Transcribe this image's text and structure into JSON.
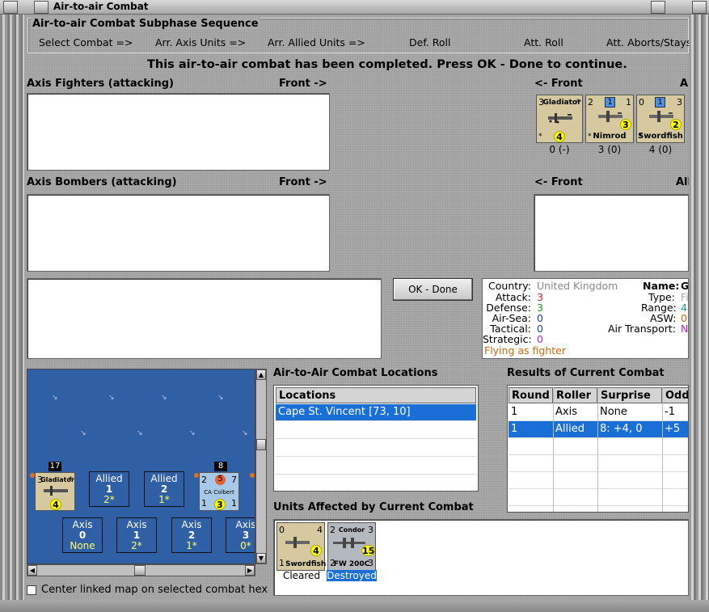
{
  "window": {
    "title": "Air-to-air Combat"
  },
  "sequence": {
    "title": "Air-to-air Combat Subphase Sequence",
    "steps": [
      "Select Combat =>",
      "Arr. Axis Units =>",
      "Arr. Allied Units =>",
      "Def. Roll",
      "Att. Roll",
      "Att. Aborts/Stays"
    ]
  },
  "message": "This air-to-air combat has been completed.  Press OK - Done to continue.",
  "axis_fighters": {
    "label": "Axis Fighters (attacking)",
    "front": "Front ->"
  },
  "axis_bombers": {
    "label": "Axis Bombers (attacking)",
    "front": "Front ->"
  },
  "allied_fighters": {
    "front": "<- Front",
    "label_cut": "A"
  },
  "allied_bombers": {
    "front": "<- Front",
    "label_cut": "All"
  },
  "allied_units": [
    {
      "name": "Gladiator",
      "tl": "3",
      "tr": "*",
      "circle": "4",
      "status": "0 (-)"
    },
    {
      "name": "Nimrod",
      "tl": "2",
      "tr": "1",
      "box": "1",
      "circle": "3",
      "status": "3 (0)"
    },
    {
      "name": "Swordfish",
      "tl": "0",
      "tr": "3",
      "box": "1",
      "circle": "2",
      "status": "4 (0)"
    }
  ],
  "ok_button": "OK - Done",
  "info": {
    "country_label": "Country:",
    "country": "United Kingdom",
    "attack_label": "Attack:",
    "attack": "3",
    "defense_label": "Defense:",
    "defense": "3",
    "airsea_label": "Air-Sea:",
    "airsea": "0",
    "tactical_label": "Tactical:",
    "tactical": "0",
    "strategic_label": "Strategic:",
    "strategic": "0",
    "flying": "Flying as fighter",
    "name_label": "Name:",
    "name": "G",
    "type_label": "Type:",
    "type": "Fi",
    "range_label": "Range:",
    "range": "4",
    "asw_label": "ASW:",
    "asw": "0",
    "airtransport_label": "Air Transport:",
    "airtransport": "No",
    "colors": {
      "country": "#8a8a8a",
      "attack": "#d02020",
      "defense": "#1a9a1a",
      "airsea": "#1a40c0",
      "tactical": "#1a40c0",
      "strategic": "#c020c0",
      "flying": "#c86a10"
    }
  },
  "map": {
    "stack1": {
      "count": "17",
      "name": "Gladiator",
      "tl": "3",
      "tr": "*",
      "circle": "4"
    },
    "stack2": {
      "count": "8",
      "name": "CA Colbert",
      "tl": "2",
      "mid": "5",
      "tr": "7",
      "bl": "1",
      "circle": "3",
      "br": "1"
    },
    "allied_cells": [
      {
        "title": "Allied",
        "value": "1",
        "sub": "2*"
      },
      {
        "title": "Allied",
        "value": "2",
        "sub": "1*"
      }
    ],
    "axis_cells": [
      {
        "title": "Axis",
        "value": "0",
        "sub": "None"
      },
      {
        "title": "Axis",
        "value": "1",
        "sub": "2*"
      },
      {
        "title": "Axis",
        "value": "2",
        "sub": "1*"
      },
      {
        "title": "Axis",
        "value": "3",
        "sub": "0*"
      }
    ]
  },
  "locations": {
    "title": "Air-to-Air Combat Locations",
    "header": "Locations",
    "rows": [
      "Cape St. Vincent [73, 10]"
    ]
  },
  "results": {
    "title": "Results of Current Combat",
    "headers": [
      "Round",
      "Roller",
      "Surprise",
      "Odds"
    ],
    "rows": [
      [
        "1",
        "Axis",
        "None",
        "-1"
      ],
      [
        "1",
        "Allied",
        "8: +4, 0",
        "+5"
      ]
    ]
  },
  "affected": {
    "title": "Units Affected by Current Combat",
    "units": [
      {
        "name": "Swordfish",
        "tl": "0",
        "tr": "4",
        "bl": "1",
        "circle": "4",
        "status": "Cleared"
      },
      {
        "name": "FW 200C",
        "top": "Condor",
        "tl": "2",
        "tr": "3",
        "bl": "2",
        "br": "3",
        "circle": "15",
        "status": "Destroyed"
      }
    ]
  },
  "center_checkbox": "Center linked map on selected combat hex"
}
